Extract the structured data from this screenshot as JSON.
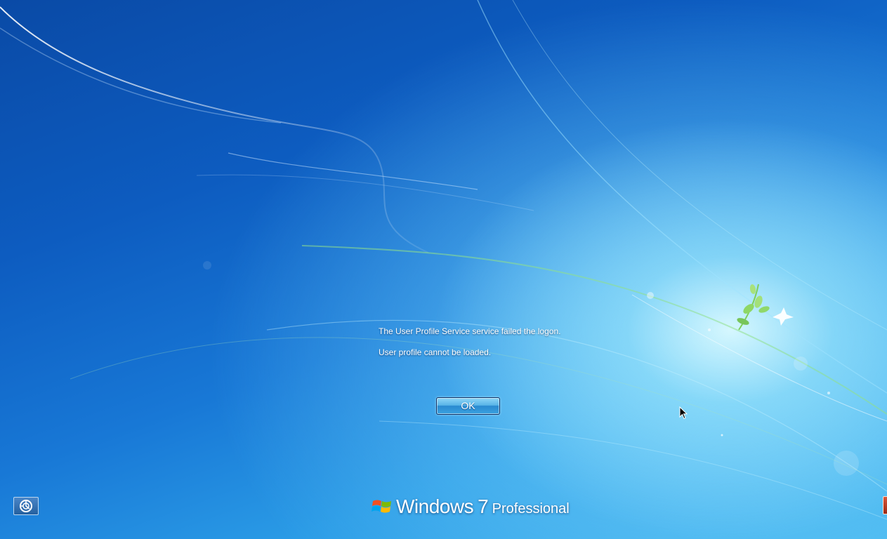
{
  "screen": {
    "type": "Windows logon error screen"
  },
  "message": {
    "line1": "The User Profile Service service failed the logon.",
    "line2": "User profile cannot be loaded."
  },
  "buttons": {
    "ok_label": "OK"
  },
  "ease_of_access": {
    "icon": "ease-of-access-icon"
  },
  "branding": {
    "name": "Windows",
    "version": "7",
    "edition": "Professional",
    "logo_icon": "windows-flag-icon"
  },
  "shutdown": {
    "icon": "power-icon"
  },
  "colors": {
    "background_primary": "#0d5cc0",
    "background_glow": "#aee8fb",
    "text": "#ffffff",
    "button_border": "#0d2f63",
    "shutdown_red": "#c2442a"
  }
}
